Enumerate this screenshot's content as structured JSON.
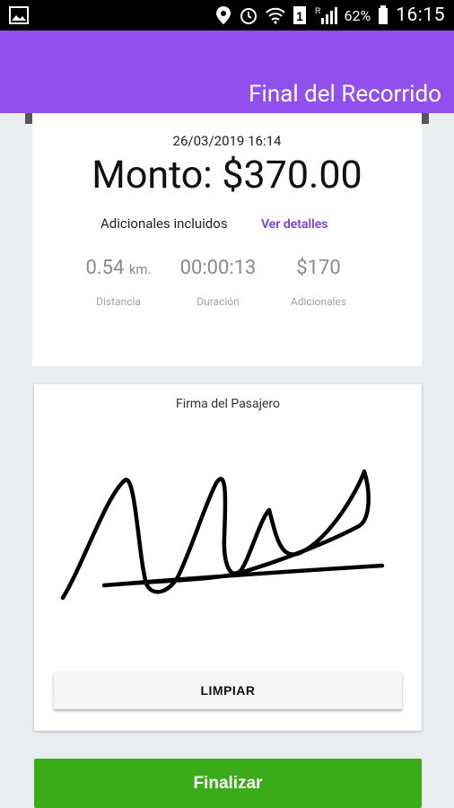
{
  "status_bar": {
    "time": "16:15",
    "battery": "62%",
    "icons": [
      "image-icon",
      "location-icon",
      "alarm-icon",
      "wifi-icon",
      "sim-1-icon",
      "signal-icon",
      "battery-icon"
    ]
  },
  "appbar": {
    "title": "Final del Recorrido",
    "color": "#9150ee"
  },
  "receipt": {
    "datetime": "26/03/2019 16:14",
    "amount": "Monto: $370.00",
    "extras_label": "Adicionales incluidos",
    "details_link": "Ver detalles",
    "metrics": [
      {
        "value": "0.54",
        "unit": "km.",
        "label": "Distancia"
      },
      {
        "value": "00:00:13",
        "unit": "",
        "label": "Duración"
      },
      {
        "value": "$170",
        "unit": "",
        "label": "Adicionales"
      }
    ]
  },
  "signature": {
    "label": "Firma del Pasajero",
    "clear_button": "LIMPIAR"
  },
  "finish_button": {
    "label": "Finalizar",
    "color": "#3cab19"
  }
}
